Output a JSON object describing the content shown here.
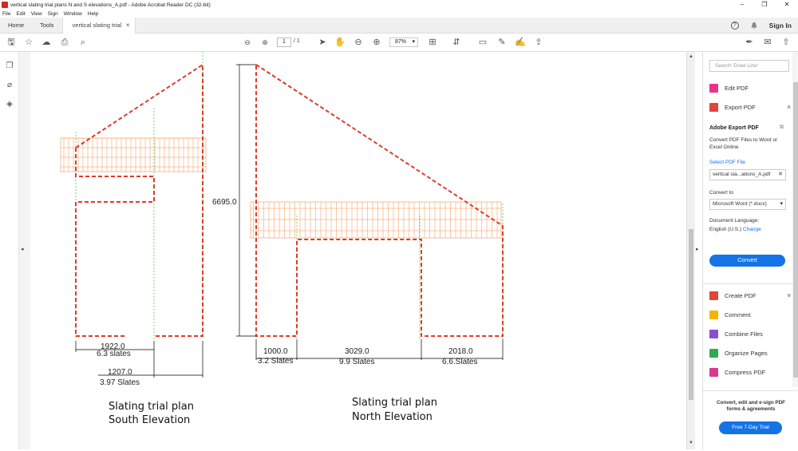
{
  "window": {
    "title": "vertical slating trial plans N and S elevations_A.pdf - Adobe Acrobat Reader DC (32-bit)",
    "controls": [
      "–",
      "❐",
      "✕"
    ]
  },
  "menu": [
    "File",
    "Edit",
    "View",
    "Sign",
    "Window",
    "Help"
  ],
  "tabs": {
    "home": "Home",
    "tools": "Tools",
    "document": "vertical slating trial ...",
    "close": "×"
  },
  "account": {
    "help": "?",
    "signin": "Sign In"
  },
  "toolbar": {
    "page_current": "1",
    "page_total": "/ 1",
    "zoom": "87%"
  },
  "drawing": {
    "south": {
      "dim_width": "1922.0",
      "dim_width_slates": "6.3 slates",
      "dim_lower": "1207.0",
      "dim_lower_slates": "3.97 Slates",
      "caption_line1": "Slating trial plan",
      "caption_line2": "South Elevation"
    },
    "north": {
      "dim_height": "6695.0",
      "dim_a": "1000.0",
      "dim_a_slates": "3.2 Slates",
      "dim_b": "3029.0",
      "dim_b_slates": "9.9 Slates",
      "dim_c": "2018.0",
      "dim_c_slates": "6.6.Slates",
      "caption_line1": "Slating trial plan",
      "caption_line2": "North Elevation"
    }
  },
  "right_pane": {
    "search_placeholder": "Search 'Draw Line'",
    "edit_pdf": "Edit PDF",
    "export_pdf": "Export PDF",
    "export_heading": "Adobe Export PDF",
    "export_desc": "Convert PDF Files to Word or Excel Online",
    "select_file": "Select PDF File",
    "file_name": "vertical sla...ations_A.pdf",
    "convert_to_label": "Convert to",
    "convert_to_value": "Microsoft Word (*.docx)",
    "doc_lang_label": "Document Language:",
    "doc_lang_value": "English (U.S.)",
    "change": "Change",
    "convert_btn": "Convert",
    "create_pdf": "Create PDF",
    "comment": "Comment",
    "combine_files": "Combine Files",
    "organize_pages": "Organize Pages",
    "compress_pdf": "Compress PDF",
    "promo": "Convert, edit and e-sign PDF forms & agreements",
    "trial_btn": "Free 7-Day Trial"
  },
  "colors": {
    "slate_outline": "#e03a2c",
    "tile_grid": "#f4a46a",
    "guide_green": "#38c238",
    "accent": "#1473e6"
  }
}
